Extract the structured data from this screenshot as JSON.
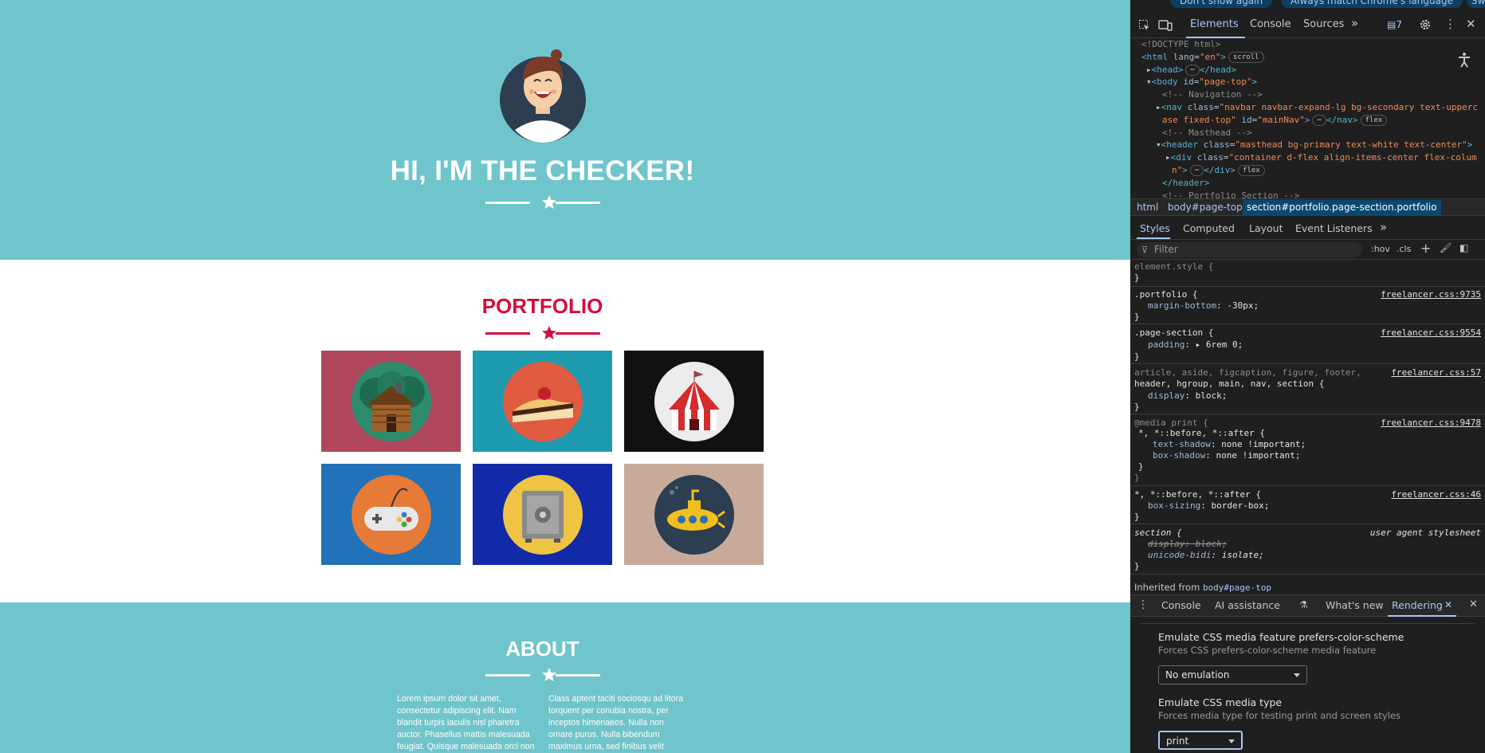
{
  "page": {
    "hero_title": "HI, I'M THE CHECKER!",
    "portfolio_title": "PORTFOLIO",
    "about_title": "ABOUT",
    "about_col1": "Lorem ipsum dolor sit amet, consectetur adipiscing elit. Nam blandit turpis iaculis nisl pharetra auctor. Phasellus mattis malesuada feugiat. Quisque malesuada orci non risus scelerisque bibendum.",
    "about_col2": "Class aptent taciti sociosqu ad litora torquent per conubia nostra, per inceptos himenaeos. Nulla non ornare purus. Nulla bibendum maximus urna, sed finibus velit tristique vel. Vivamus",
    "tiles": [
      {
        "icon": "cabin-icon",
        "bg": "#b0465c"
      },
      {
        "icon": "cake-icon",
        "bg": "#1f9bb0"
      },
      {
        "icon": "circus-tent-icon",
        "bg": "#111111"
      },
      {
        "icon": "game-controller-icon",
        "bg": "#2172b8"
      },
      {
        "icon": "safe-icon",
        "bg": "#1229a8"
      },
      {
        "icon": "submarine-icon",
        "bg": "#c8aa9b"
      }
    ],
    "colors": {
      "masthead": "#6fc5cb",
      "accent": "#d40c3f",
      "heading_dark": "#2c3e50"
    }
  },
  "devtools": {
    "notify": {
      "dont_show": "Don't show again",
      "match_lang": "Always match Chrome's language",
      "extra": "Sw"
    },
    "tabs": [
      "Elements",
      "Console",
      "Sources"
    ],
    "issues_count": "7",
    "dom": {
      "doctype": "<!DOCTYPE html>",
      "html_open": "<html",
      "html_attr": "lang",
      "html_val": "\"en\"",
      "scroll_badge": "scroll",
      "head": "<head>",
      "head_close": "</head>",
      "body_open": "<body",
      "body_attr": "id",
      "body_val": "\"page-top\"",
      "c_nav": "<!-- Navigation -->",
      "nav_open": "<nav",
      "nav_class": "class",
      "nav_class_val_1": "\"navbar navbar-expand-lg bg-secondary text-upperc",
      "nav_class_val_2": "ase fixed-top\"",
      "nav_id": "id",
      "nav_id_val": "\"mainNav\"",
      "nav_close": "</nav>",
      "flex": "flex",
      "c_mast": "<!-- Masthead -->",
      "header_open": "<header",
      "header_class": "class",
      "header_class_val": "\"masthead bg-primary text-white text-center\"",
      "div_open": "<div",
      "div_class": "class",
      "div_class_val_1": "\"container d-flex align-items-center flex-colum",
      "div_class_val_2": "n\"",
      "div_close": "</div>",
      "header_close": "</header>",
      "c_port": "<!-- Portfolio Section -->"
    },
    "breadcrumbs": [
      "html",
      "body#page-top",
      "section#portfolio.page-section.portfolio"
    ],
    "subtabs": [
      "Styles",
      "Computed",
      "Layout",
      "Event Listeners"
    ],
    "filter_placeholder": "Filter",
    "hov": ":hov",
    "cls": ".cls",
    "styles": {
      "element_style": "element.style {",
      "close": "}",
      "portfolio_sel": ".portfolio {",
      "portfolio_prop": "margin-bottom",
      "portfolio_val": "-30px;",
      "link_9735": "freelancer.css:9735",
      "ps_sel": ".page-section {",
      "ps_prop": "padding",
      "ps_val": "6rem 0;",
      "link_9554": "freelancer.css:9554",
      "art_sel_1": "article, aside, figcaption, figure, footer,",
      "art_sel_2": "header, hgroup, main, nav, section {",
      "art_prop": "display",
      "art_val": "block;",
      "link_57": "freelancer.css:57",
      "media": "@media print {",
      "media_sel": "*, *::before, *::after {",
      "ts_prop": "text-shadow",
      "ts_val": "none !important;",
      "bs_prop": "box-shadow",
      "bs_val": "none !important;",
      "link_9478": "freelancer.css:9478",
      "star_sel": "*, *::before, *::after {",
      "bxs_prop": "box-sizing",
      "bxs_val": "border-box;",
      "link_46": "freelancer.css:46",
      "section_sel": "section {",
      "ua": "user agent stylesheet",
      "ua_disp": "display: block;",
      "ua_bidi_prop": "unicode-bidi",
      "ua_bidi_val": "isolate;",
      "inherited": "Inherited from",
      "inherited_link": "body#page-top"
    },
    "drawer_tabs": [
      "Console",
      "AI assistance",
      "What's new",
      "Rendering"
    ],
    "rendering": {
      "scheme_title": "Emulate CSS media feature prefers-color-scheme",
      "scheme_sub": "Forces CSS prefers-color-scheme media feature",
      "scheme_value": "No emulation",
      "type_title": "Emulate CSS media type",
      "type_sub": "Forces media type for testing print and screen styles",
      "type_value": "print"
    }
  }
}
